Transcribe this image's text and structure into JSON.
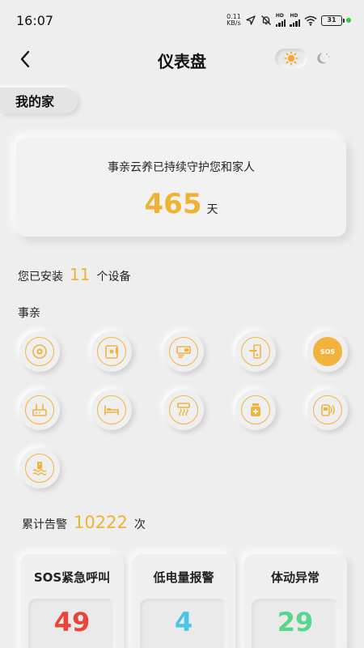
{
  "status_bar": {
    "time": "16:07",
    "net_speed_value": "0.11",
    "net_speed_unit": "KB/s",
    "battery": "31",
    "icons": [
      "location-arrow-icon",
      "mute-bell-icon",
      "hd-signal-icon",
      "hd-signal-icon",
      "wifi-icon",
      "battery-icon"
    ]
  },
  "header": {
    "title": "仪表盘",
    "back_icon": "chevron-left-icon",
    "theme_light_icon": "sun-icon",
    "theme_dark_icon": "moon-icon"
  },
  "home": {
    "label": "我的家"
  },
  "guard": {
    "text": "事亲云养已持续守护您和家人",
    "days": "465",
    "unit": "天"
  },
  "devices_summary": {
    "prefix": "您已安装",
    "count": "11",
    "suffix": "个设备"
  },
  "section": {
    "label": "事亲"
  },
  "devices": [
    {
      "icon": "smoke-detector-icon"
    },
    {
      "icon": "door-sensor-icon"
    },
    {
      "icon": "gas-detector-icon"
    },
    {
      "icon": "door-lock-icon"
    },
    {
      "icon": "sos-button-icon",
      "text": "SOS"
    },
    {
      "icon": "gateway-router-icon"
    },
    {
      "icon": "bed-sensor-icon"
    },
    {
      "icon": "water-heater-icon"
    },
    {
      "icon": "medicine-box-icon"
    },
    {
      "icon": "wearable-alarm-icon"
    },
    {
      "icon": "water-leak-sensor-icon"
    }
  ],
  "alarms": {
    "prefix": "累计告警",
    "count": "10222",
    "suffix": "次"
  },
  "stats": [
    {
      "label": "SOS紧急呼叫",
      "value": "49",
      "color": "#e8443a"
    },
    {
      "label": "低电量报警",
      "value": "4",
      "color": "#4cc3e8"
    },
    {
      "label": "体动异常",
      "value": "29",
      "color": "#58d68d"
    }
  ],
  "colors": {
    "accent": "#f0b232",
    "background": "#eeeeee",
    "icon_orange": "#f2b33d"
  }
}
